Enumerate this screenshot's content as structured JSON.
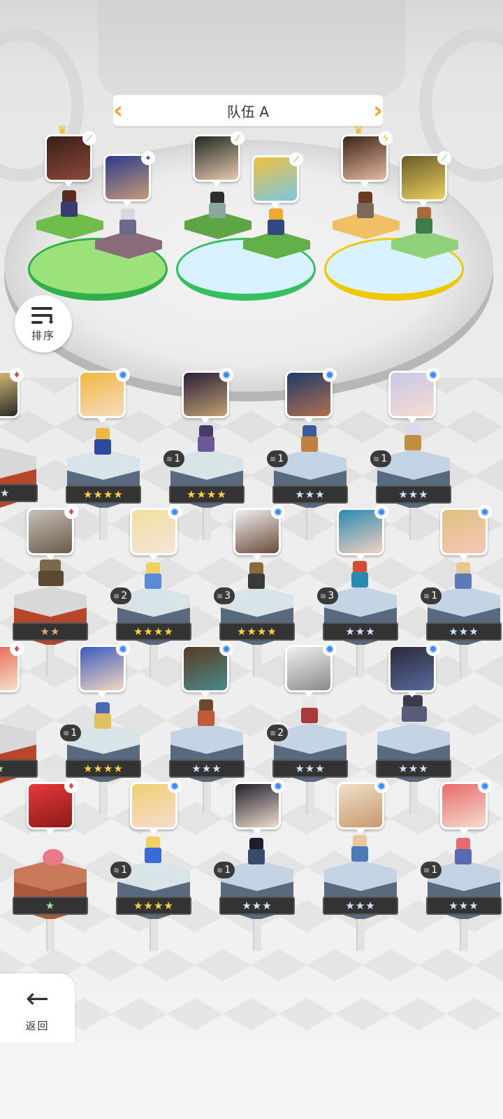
{
  "team": {
    "title": "队伍 A"
  },
  "sort": {
    "label": "排序"
  },
  "back": {
    "label": "返回"
  },
  "colors": {
    "accent_orange": "#f5a623",
    "element_blue": "#3d8bff",
    "element_red": "#e24a4a",
    "star_gold": "#ffd23c",
    "star_silver": "#cfe4ff",
    "star_green": "#9be79b",
    "star_red": "#e8a08a"
  },
  "team_members": [
    {
      "slot": 1,
      "portrait": "hooded-rogue-portrait",
      "element": "wind",
      "leader": true
    },
    {
      "slot": 1,
      "portrait": "bearded-warrior-portrait",
      "element": "dark"
    },
    {
      "slot": 2,
      "portrait": "green-haired-girl-portrait",
      "element": "wind"
    },
    {
      "slot": 2,
      "portrait": "fox-boy-portrait",
      "element": "wind"
    },
    {
      "slot": 3,
      "portrait": "glasses-girl-portrait",
      "element": "light",
      "leader": true
    },
    {
      "slot": 3,
      "portrait": "owl-portrait",
      "element": "wind"
    }
  ],
  "roster": [
    {
      "row": 1,
      "portrait": "partial-hero-portrait",
      "stars": "★★",
      "element": "red",
      "level": ""
    },
    {
      "row": 1,
      "portrait": "blonde-boy-portrait",
      "stars": "★★★★",
      "element": "blue",
      "level": ""
    },
    {
      "row": 1,
      "portrait": "purple-hair-portrait",
      "stars": "★★★★",
      "element": "blue",
      "level": "1"
    },
    {
      "row": 1,
      "portrait": "blue-bandana-portrait",
      "stars": "★★★",
      "element": "blue",
      "level": "1"
    },
    {
      "row": 1,
      "portrait": "winking-girl-portrait",
      "stars": "★★★",
      "element": "blue",
      "level": "1"
    },
    {
      "row": 2,
      "portrait": "golem-portrait",
      "stars": "★★",
      "element": "red",
      "level": ""
    },
    {
      "row": 2,
      "portrait": "blonde-maid-portrait",
      "stars": "★★★★",
      "element": "blue",
      "level": "2"
    },
    {
      "row": 2,
      "portrait": "scarred-man-portrait",
      "stars": "★★★★",
      "element": "blue",
      "level": "3"
    },
    {
      "row": 2,
      "portrait": "teal-hair-girl-portrait",
      "stars": "★★★",
      "element": "blue",
      "level": "3"
    },
    {
      "row": 2,
      "portrait": "shocked-girl-portrait",
      "stars": "★★★",
      "element": "blue",
      "level": "1"
    },
    {
      "row": 3,
      "portrait": "partial-mushroom-portrait",
      "stars": "★",
      "element": "red",
      "level": ""
    },
    {
      "row": 3,
      "portrait": "blue-hood-girl-portrait",
      "stars": "★★★★",
      "element": "blue",
      "level": "1"
    },
    {
      "row": 3,
      "portrait": "cowboy-portrait",
      "stars": "★★★",
      "element": "blue",
      "level": ""
    },
    {
      "row": 3,
      "portrait": "white-wolf-portrait",
      "stars": "★★★",
      "element": "blue",
      "level": "2"
    },
    {
      "row": 3,
      "portrait": "dark-dragon-portrait",
      "stars": "★★★",
      "element": "blue",
      "level": ""
    },
    {
      "row": 4,
      "portrait": "red-blob-portrait",
      "stars": "★",
      "element": "red",
      "level": ""
    },
    {
      "row": 4,
      "portrait": "blonde-bow-girl-portrait",
      "stars": "★★★★",
      "element": "blue",
      "level": "1"
    },
    {
      "row": 4,
      "portrait": "dark-hair-woman-portrait",
      "stars": "★★★",
      "element": "blue",
      "level": "1"
    },
    {
      "row": 4,
      "portrait": "fox-creature-portrait",
      "stars": "★★★",
      "element": "blue",
      "level": ""
    },
    {
      "row": 4,
      "portrait": "pink-hair-girl-portrait",
      "stars": "★★★",
      "element": "blue",
      "level": "1"
    }
  ]
}
